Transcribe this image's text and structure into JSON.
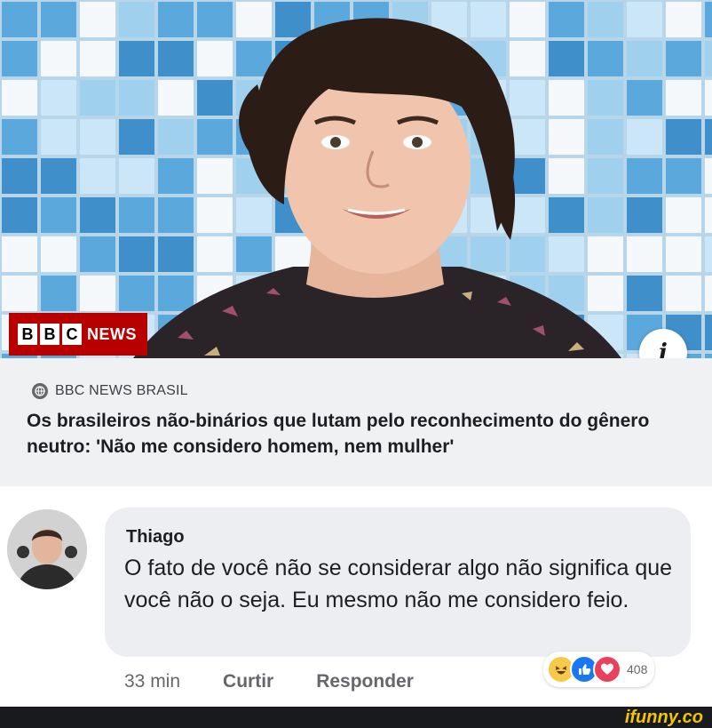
{
  "hero": {
    "badge_letters": [
      "B",
      "B",
      "C"
    ],
    "badge_word": "NEWS",
    "info_glyph": "i"
  },
  "link_card": {
    "source": "BBC NEWS BRASIL",
    "headline": "Os brasileiros não-binários que lutam pelo reconhecimento do gênero neutro: 'Não me considero homem, nem mulher'"
  },
  "comment": {
    "author": "Thiago",
    "text": "O fato de você não se considerar algo não significa que você não o seja. Eu mesmo não me considero feio.",
    "time": "33 min",
    "like_label": "Curtir",
    "reply_label": "Responder",
    "reactions": [
      "haha-icon",
      "like-icon",
      "love-icon"
    ],
    "reaction_count": "408"
  },
  "watermark": "ifunny.co",
  "colors": {
    "bbc_red": "#b80000",
    "card_bg": "#f0f1f3",
    "bubble_bg": "#eceef1",
    "ifunny_yellow": "#f4c600",
    "facebook_blue": "#1877f2"
  }
}
